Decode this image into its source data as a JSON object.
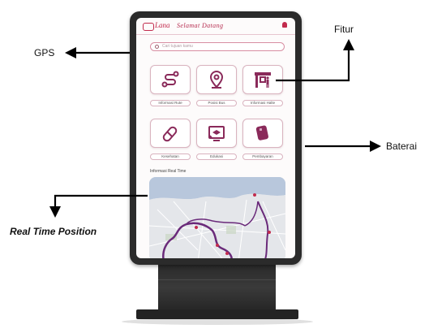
{
  "annotations": {
    "gps": "GPS",
    "fitur": "Fitur",
    "baterai": "Baterai",
    "realtime": "Real Time Position"
  },
  "app": {
    "logo": "Lana",
    "welcome": "Selamat Datang",
    "search_placeholder": "Cari tujuan kamu",
    "menu": [
      {
        "label": "Informasi Rute",
        "icon": "route-icon"
      },
      {
        "label": "Posisi Bus",
        "icon": "location-pin-icon"
      },
      {
        "label": "Informasi Halte",
        "icon": "bus-stop-icon"
      },
      {
        "label": "Kesehatan",
        "icon": "pill-icon"
      },
      {
        "label": "Edukasi",
        "icon": "education-icon"
      },
      {
        "label": "Pembayaran",
        "icon": "card-icon"
      }
    ],
    "realtime_title": "Informasi Real Time"
  },
  "colors": {
    "accent": "#8a2a5a",
    "brand": "#c22b4d",
    "route": "#6a2a7a"
  }
}
